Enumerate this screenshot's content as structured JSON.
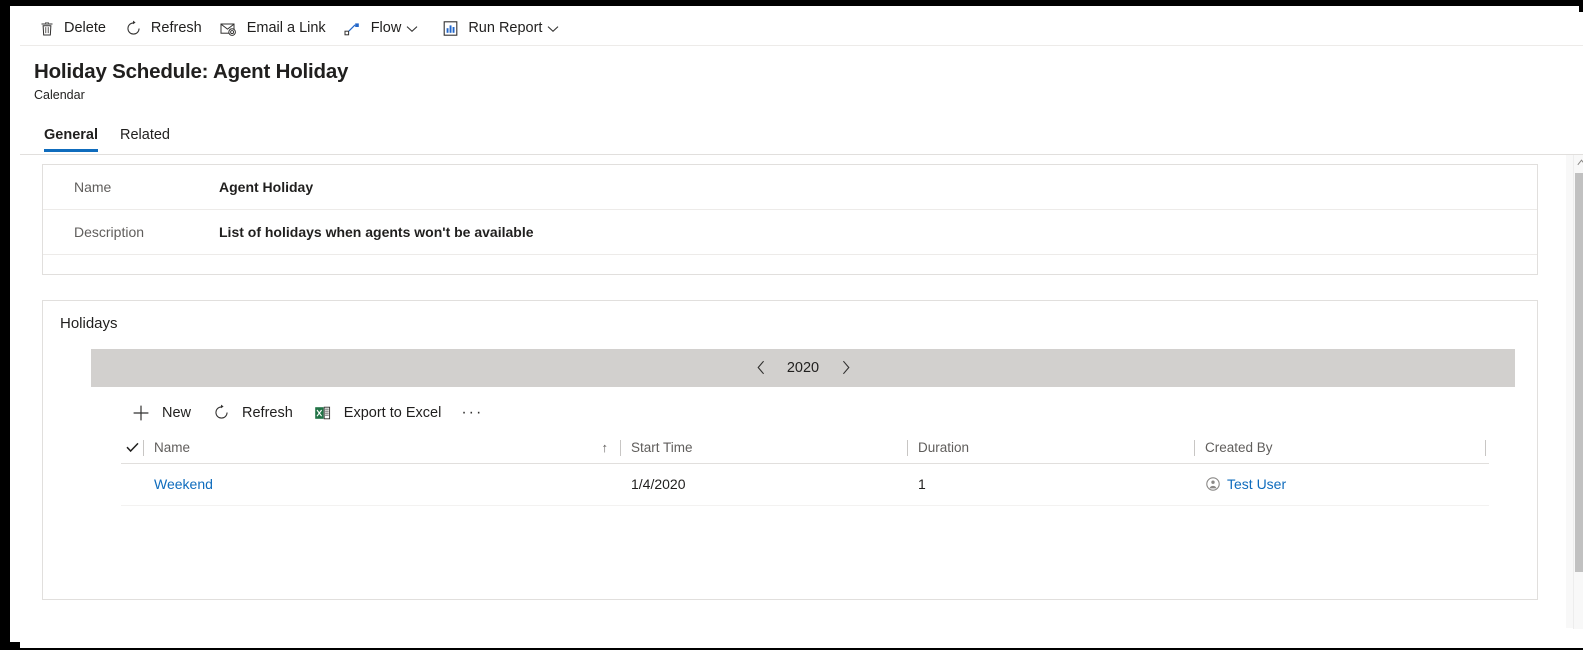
{
  "command_bar": {
    "items": [
      {
        "label": "Delete",
        "icon": "trash-icon",
        "has_caret": false
      },
      {
        "label": "Refresh",
        "icon": "refresh-icon",
        "has_caret": false
      },
      {
        "label": "Email a Link",
        "icon": "email-link-icon",
        "has_caret": false
      },
      {
        "label": "Flow",
        "icon": "flow-icon",
        "has_caret": true
      },
      {
        "label": "Run Report",
        "icon": "report-icon",
        "has_caret": true
      }
    ]
  },
  "header": {
    "title": "Holiday Schedule: Agent Holiday",
    "subtitle": "Calendar"
  },
  "tabs": [
    {
      "label": "General",
      "active": true
    },
    {
      "label": "Related",
      "active": false
    }
  ],
  "general": {
    "fields": [
      {
        "label": "Name",
        "value": "Agent Holiday"
      },
      {
        "label": "Description",
        "value": "List of holidays when agents won't be available"
      }
    ]
  },
  "holidays": {
    "title": "Holidays",
    "year_nav": {
      "prev_icon": "chevron-left-icon",
      "next_icon": "chevron-right-icon",
      "year": "2020"
    },
    "grid_command_bar": {
      "items": [
        {
          "label": "New",
          "icon": "plus-icon"
        },
        {
          "label": "Refresh",
          "icon": "refresh-icon"
        },
        {
          "label": "Export to Excel",
          "icon": "excel-icon"
        }
      ],
      "overflow_label": "···"
    },
    "grid": {
      "select_all_icon": "checkmark-icon",
      "columns": [
        {
          "label": "Name",
          "sorted": true,
          "sort_icon": "↑"
        },
        {
          "label": "Start Time",
          "sorted": false,
          "sort_icon": ""
        },
        {
          "label": "Duration",
          "sorted": false,
          "sort_icon": ""
        },
        {
          "label": "Created By",
          "sorted": false,
          "sort_icon": ""
        }
      ],
      "rows": [
        {
          "name": "Weekend",
          "start_time": "1/4/2020",
          "duration": "1",
          "created_by": "Test User",
          "created_by_icon": "user-avatar-icon"
        }
      ]
    }
  },
  "scrollbar": {
    "up_arrow_icon": "scroll-up-arrow-icon"
  },
  "colors": {
    "accent": "#0f6cbd",
    "link": "#0f6cbd",
    "year_band": "#d2d0ce",
    "text": "#201f1e",
    "muted_text": "#605e5c",
    "border": "#e1dfdd"
  }
}
